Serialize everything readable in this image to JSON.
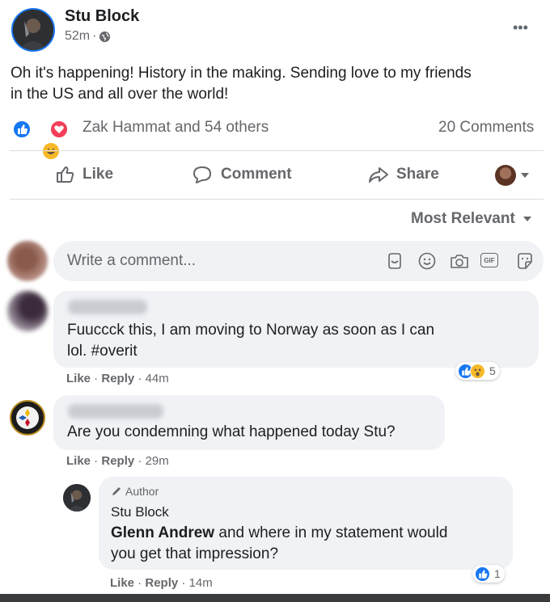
{
  "post": {
    "author": "Stu Block",
    "time": "52m",
    "separator": "·",
    "text_line1": "Oh it's happening! History in the making. Sending love to my friends",
    "text_line2": "in the US and all over the world!",
    "reactions_text": "Zak Hammat and 54 others",
    "comments_count": "20 Comments",
    "more_icon": "•••"
  },
  "actions": {
    "like": "Like",
    "comment": "Comment",
    "share": "Share"
  },
  "sort_label": "Most Relevant",
  "composer": {
    "placeholder": "Write a comment...",
    "gif_label": "GIF"
  },
  "comments": [
    {
      "line1": "Fuuccck this, I am moving to Norway as soon as I can",
      "line2": "lol. #overit",
      "like": "Like",
      "reply": "Reply",
      "time": "44m",
      "reaction_count": "5"
    },
    {
      "line1": "Are you condemning what happened today Stu?",
      "like": "Like",
      "reply": "Reply",
      "time": "29m"
    }
  ],
  "reply": {
    "badge": "Author",
    "author": "Stu Block",
    "mention": "Glenn Andrew",
    "line1_rest": " and where in my statement would",
    "line2": "you get that impression?",
    "like": "Like",
    "reply": "Reply",
    "time": "14m",
    "reaction_count": "1"
  },
  "colors": {
    "brand_blue": "#1877f2",
    "love_red": "#f33e58",
    "haha_yellow": "#f7b928",
    "bubble_gray": "#f0f2f5",
    "muted_text": "#65676b"
  }
}
